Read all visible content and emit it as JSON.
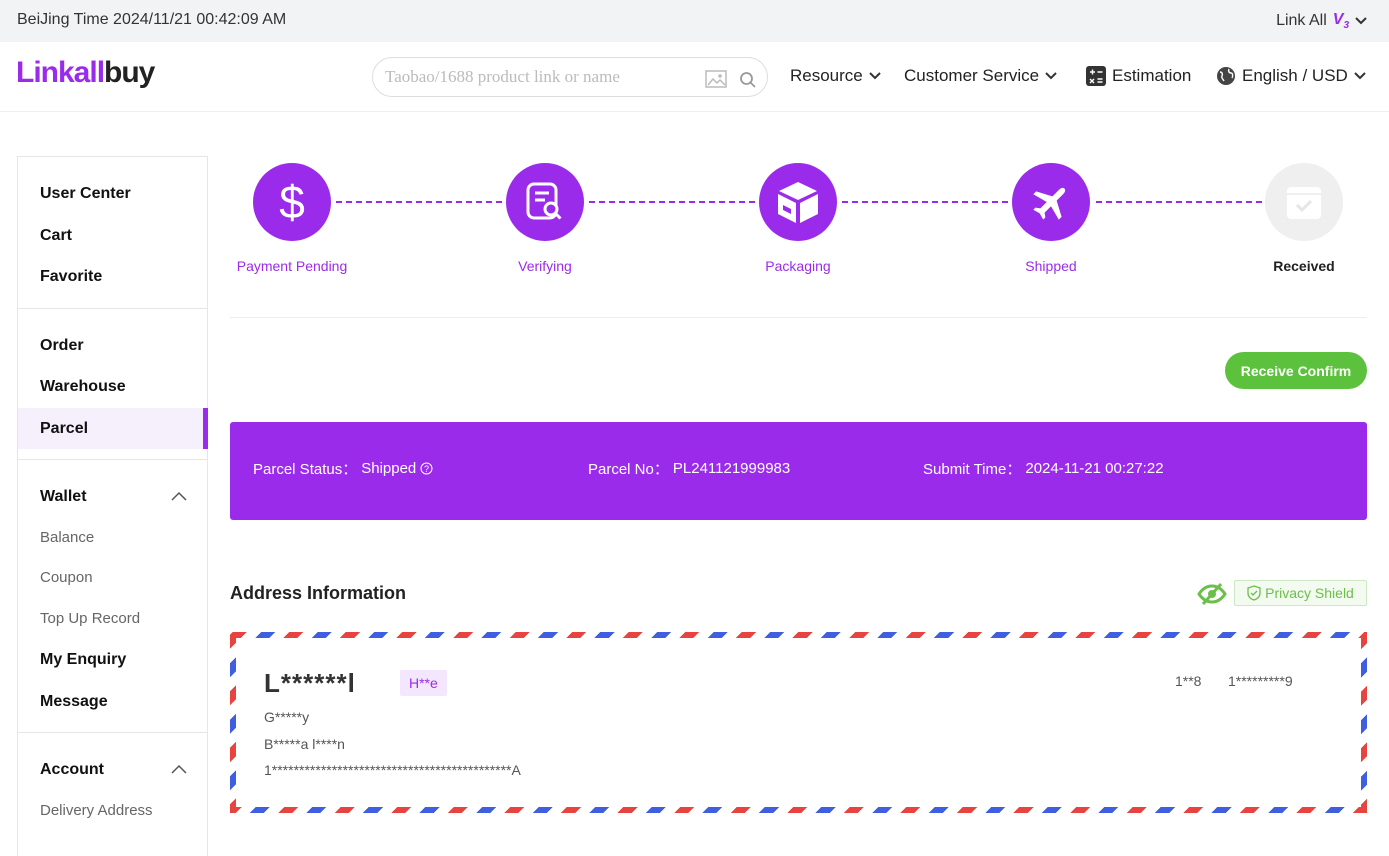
{
  "topbar": {
    "time": "BeiJing Time 2024/11/21 00:42:09 AM",
    "link_all": "Link All",
    "version": "V",
    "version_sub": "3"
  },
  "header": {
    "logo_part1": "Linkall",
    "logo_part2": "buy",
    "search_placeholder": "Taobao/1688 product link or name",
    "nav": {
      "resource": "Resource",
      "customer_service": "Customer Service",
      "estimation": "Estimation",
      "language": "English / USD"
    }
  },
  "sidebar": {
    "group1": [
      "User Center",
      "Cart",
      "Favorite"
    ],
    "group2": [
      "Order",
      "Warehouse",
      "Parcel"
    ],
    "wallet": {
      "title": "Wallet",
      "items": [
        "Balance",
        "Coupon",
        "Top Up Record"
      ]
    },
    "group4": [
      "My Enquiry",
      "Message"
    ],
    "account": {
      "title": "Account",
      "items": [
        "Delivery Address"
      ]
    }
  },
  "steps": [
    {
      "label": "Payment Pending",
      "icon": "dollar-icon"
    },
    {
      "label": "Verifying",
      "icon": "document-search-icon"
    },
    {
      "label": "Packaging",
      "icon": "box-icon"
    },
    {
      "label": "Shipped",
      "icon": "airplane-icon"
    },
    {
      "label": "Received",
      "icon": "received-box-icon"
    }
  ],
  "actions": {
    "receive_confirm": "Receive Confirm"
  },
  "parcel": {
    "status_label": "Parcel Status：",
    "status_value": "Shipped",
    "no_label": "Parcel No：",
    "no_value": "PL241121999983",
    "submit_label": "Submit Time：",
    "submit_value": "2024-11-21 00:27:22"
  },
  "address": {
    "title": "Address Information",
    "privacy": "Privacy Shield",
    "name": "L******l",
    "tag": "H**e",
    "phone_code": "1**8",
    "phone": "1*********9",
    "line1": "G*****y",
    "line2": "B*****a l****n",
    "line3": "1********************************************A"
  },
  "colors": {
    "primary": "#9b2bea",
    "confirm": "#5cc13c",
    "privacy": "#6cbf4a"
  }
}
